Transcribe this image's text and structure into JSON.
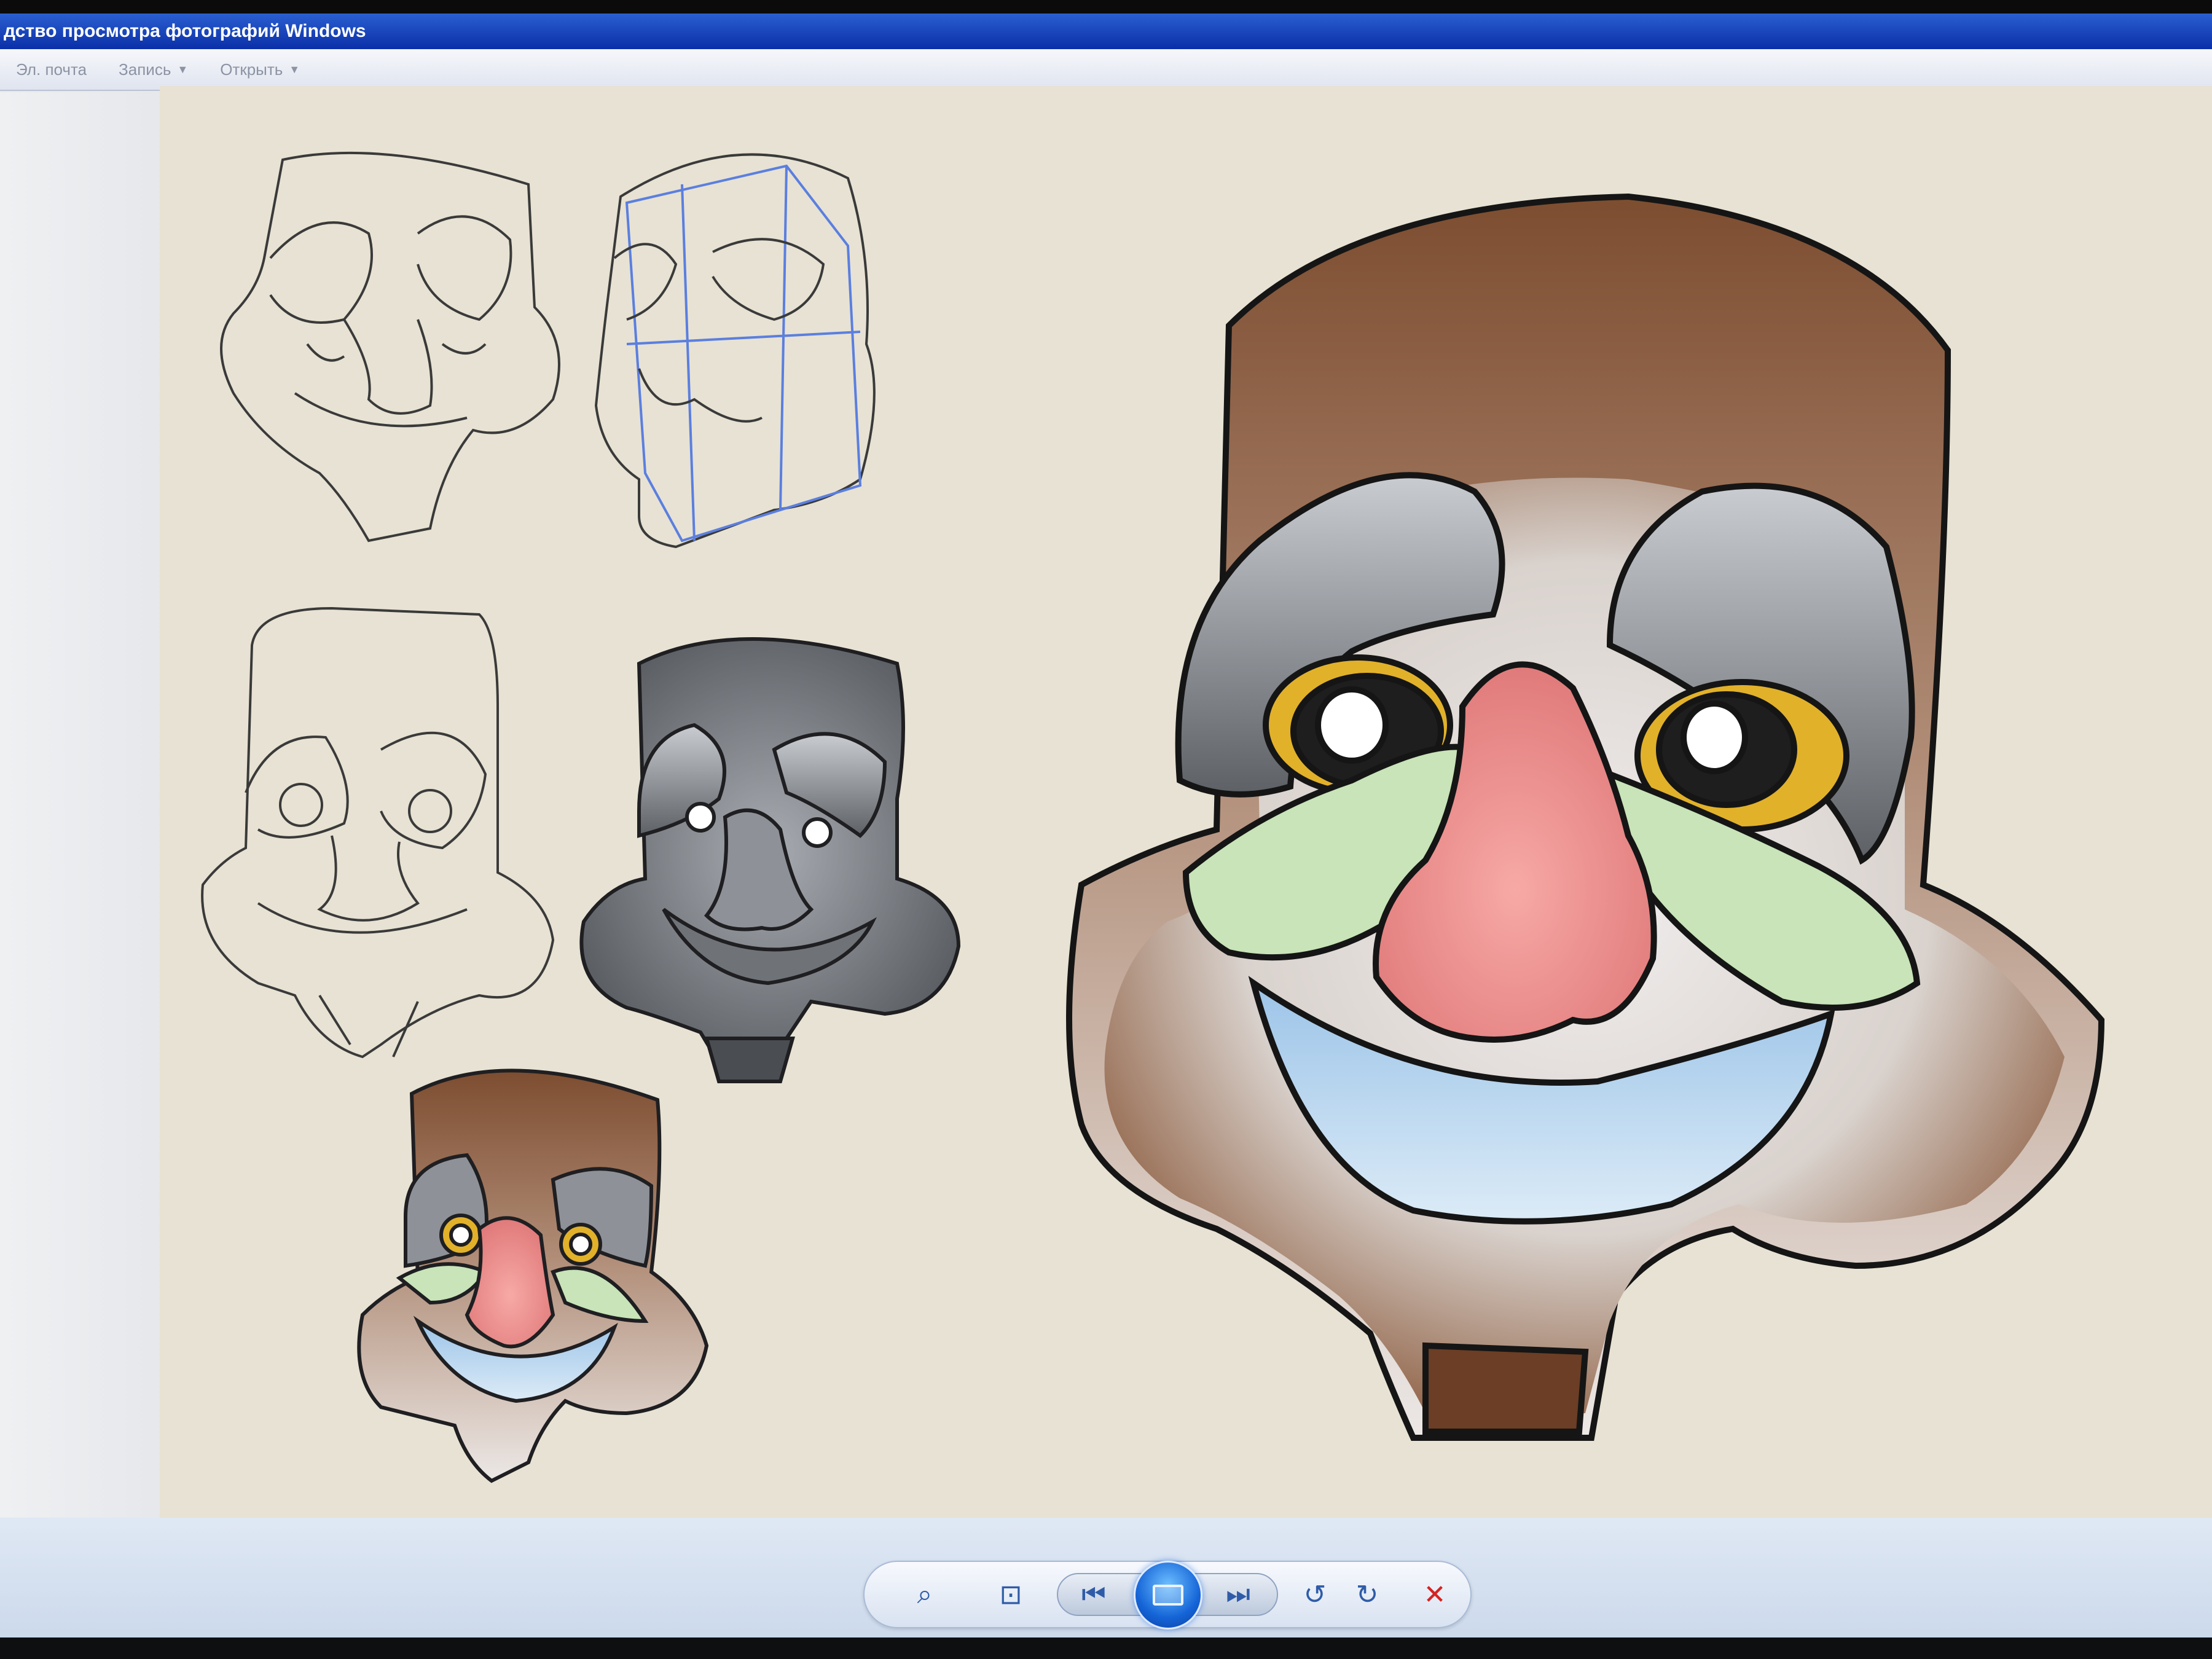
{
  "window": {
    "title": "дство просмотра фотографий Windows"
  },
  "menu": {
    "items": [
      {
        "label": "Эл. почта",
        "has_dropdown": false
      },
      {
        "label": "Запись",
        "has_dropdown": true
      },
      {
        "label": "Открыть",
        "has_dropdown": true
      }
    ]
  },
  "toolbar": {
    "buttons": [
      {
        "name": "zoom-icon",
        "glyph": "🔍"
      },
      {
        "name": "actual-size-icon",
        "glyph": "⊡"
      },
      {
        "name": "previous-icon",
        "glyph": "⏮"
      },
      {
        "name": "slideshow-icon",
        "glyph": ""
      },
      {
        "name": "next-icon",
        "glyph": "⏭"
      },
      {
        "name": "rotate-left-icon",
        "glyph": "↺"
      },
      {
        "name": "rotate-right-icon",
        "glyph": "↻"
      },
      {
        "name": "delete-icon",
        "glyph": "✕"
      }
    ],
    "accent_color": "#1565d8",
    "delete_color": "#d42424"
  },
  "image": {
    "subject": "mask-sketches",
    "colors": {
      "wood": "#8b5a3c",
      "grey": "#9a9ea4",
      "nose": "#f08a8a",
      "mouth": "#a9cdea",
      "cheek": "#c8e4b8",
      "eye": "#e2b12a"
    }
  }
}
